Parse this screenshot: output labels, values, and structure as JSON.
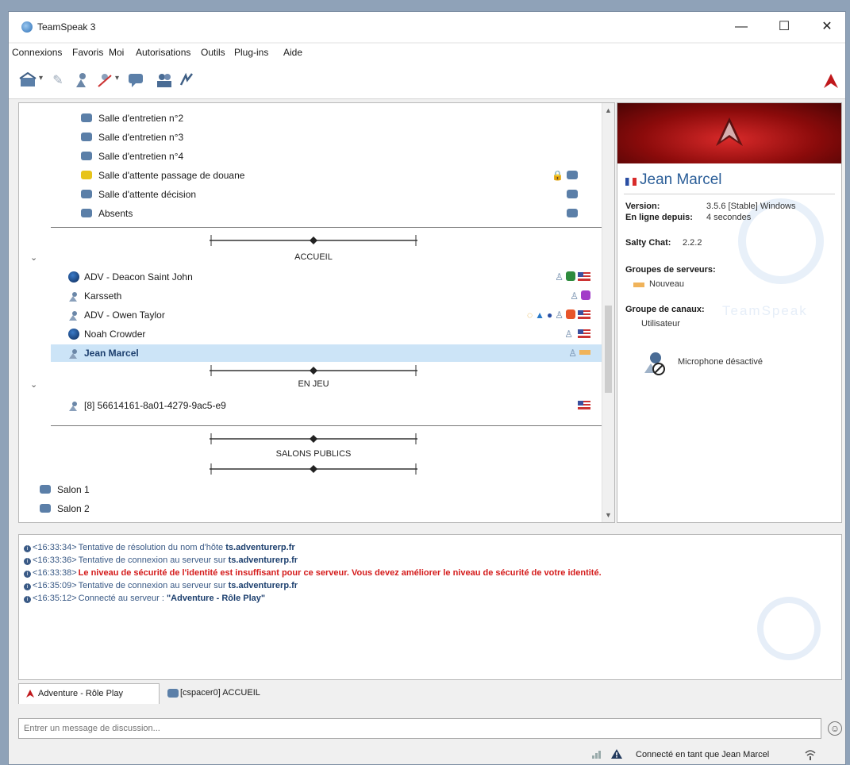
{
  "window": {
    "title": "TeamSpeak 3",
    "controls": [
      "—",
      "☐",
      "✕"
    ]
  },
  "menu": [
    "Connexions",
    "Favoris",
    "Moi",
    "Autorisations",
    "Outils",
    "Plug-ins",
    "Aide"
  ],
  "channels_top": [
    {
      "name": "Salle d'entretien n°2"
    },
    {
      "name": "Salle d'entretien n°3"
    },
    {
      "name": "Salle d'entretien n°4"
    },
    {
      "name": "Salle d'attente passage de douane"
    },
    {
      "name": "Salle d'attente décision"
    },
    {
      "name": "Absents"
    }
  ],
  "spacers": {
    "accueil": "ACCUEIL",
    "en_jeu": "EN JEU",
    "salons_publics": "SALONS PUBLICS"
  },
  "accueil_users": [
    {
      "name": "ADV - Deacon Saint John"
    },
    {
      "name": "Karsseth"
    },
    {
      "name": "ADV - Owen Taylor"
    },
    {
      "name": "Noah Crowder"
    },
    {
      "name": "Jean Marcel"
    }
  ],
  "en_jeu_users": [
    {
      "name": "[8] 56614161-8a01-4279-9ac5-e9"
    }
  ],
  "salons": [
    {
      "name": "Salon 1"
    },
    {
      "name": "Salon 2"
    }
  ],
  "info": {
    "name": "Jean Marcel",
    "version_label": "Version:",
    "version_value": "3.5.6 [Stable] Windows",
    "online_label": "En ligne depuis:",
    "online_value": "4 secondes",
    "salty_label": "Salty Chat:",
    "salty_value": "2.2.2",
    "server_groups_label": "Groupes de serveurs:",
    "server_group": "Nouveau",
    "channel_group_label": "Groupe de canaux:",
    "channel_group": "Utilisateur",
    "watermark_text": "TeamSpeak",
    "mic_status": "Microphone désactivé"
  },
  "log": [
    {
      "time": "<16:33:34>",
      "text": "Tentative de résolution du nom d'hôte ",
      "host": "ts.adventurerp.fr",
      "error": false
    },
    {
      "time": "<16:33:36>",
      "text": "Tentative de connexion au serveur sur ",
      "host": "ts.adventurerp.fr",
      "error": false
    },
    {
      "time": "<16:33:38>",
      "text": "Le niveau de sécurité de l'identité est insuffisant pour ce serveur. Vous devez améliorer le niveau de sécurité de votre identité.",
      "host": "",
      "error": true
    },
    {
      "time": "<16:35:09>",
      "text": "Tentative de connexion au serveur sur ",
      "host": "ts.adventurerp.fr",
      "error": false
    },
    {
      "time": "<16:35:12>",
      "text": "Connecté au serveur : ",
      "host": "\"Adventure - Rôle Play\"",
      "error": false
    }
  ],
  "tabs": {
    "server": "Adventure - Rôle Play",
    "channel": "[cspacer0] ACCUEIL"
  },
  "chat": {
    "placeholder": "Entrer un message de discussion..."
  },
  "status": {
    "connected_text": "Connecté en tant que Jean Marcel"
  },
  "colors": {
    "accent": "#2b5e98",
    "error": "#d41b1b",
    "selection": "#cce4f7",
    "banner": "#b01515"
  }
}
